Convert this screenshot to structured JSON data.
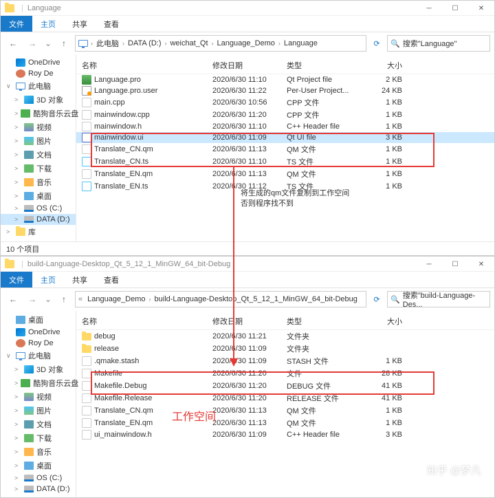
{
  "window1": {
    "title": "Language",
    "ribbon": {
      "file": "文件",
      "home": "主页",
      "share": "共享",
      "view": "查看"
    },
    "path": [
      "此电脑",
      "DATA (D:)",
      "weichat_Qt",
      "Language_Demo",
      "Language"
    ],
    "search_placeholder": "搜索\"Language\"",
    "columns": {
      "name": "名称",
      "date": "修改日期",
      "type": "类型",
      "size": "大小"
    },
    "files": [
      {
        "icon": "fi-pro",
        "name": "Language.pro",
        "date": "2020/6/30 11:10",
        "type": "Qt Project file",
        "size": "2 KB"
      },
      {
        "icon": "fi-user",
        "name": "Language.pro.user",
        "date": "2020/6/30 11:22",
        "type": "Per-User Project...",
        "size": "24 KB"
      },
      {
        "icon": "fi-cpp",
        "name": "main.cpp",
        "date": "2020/6/30 10:56",
        "type": "CPP 文件",
        "size": "1 KB"
      },
      {
        "icon": "fi-cpp",
        "name": "mainwindow.cpp",
        "date": "2020/6/30 11:20",
        "type": "CPP 文件",
        "size": "1 KB"
      },
      {
        "icon": "fi-h",
        "name": "mainwindow.h",
        "date": "2020/6/30 11:10",
        "type": "C++ Header file",
        "size": "1 KB"
      },
      {
        "icon": "fi-ui",
        "name": "mainwindow.ui",
        "date": "2020/6/30 11:09",
        "type": "Qt UI file",
        "size": "3 KB",
        "sel": true
      },
      {
        "icon": "fi-qm",
        "name": "Translate_CN.qm",
        "date": "2020/6/30 11:13",
        "type": "QM 文件",
        "size": "1 KB"
      },
      {
        "icon": "fi-ts",
        "name": "Translate_CN.ts",
        "date": "2020/6/30 11:10",
        "type": "TS 文件",
        "size": "1 KB"
      },
      {
        "icon": "fi-qm",
        "name": "Translate_EN.qm",
        "date": "2020/6/30 11:13",
        "type": "QM 文件",
        "size": "1 KB"
      },
      {
        "icon": "fi-ts",
        "name": "Translate_EN.ts",
        "date": "2020/6/30 11:12",
        "type": "TS 文件",
        "size": "1 KB"
      }
    ],
    "status": "10 个项目"
  },
  "window2": {
    "title": "build-Language-Desktop_Qt_5_12_1_MinGW_64_bit-Debug",
    "ribbon": {
      "file": "文件",
      "home": "主页",
      "share": "共享",
      "view": "查看"
    },
    "path": [
      "Language_Demo",
      "build-Language-Desktop_Qt_5_12_1_MinGW_64_bit-Debug"
    ],
    "search_placeholder": "搜索\"build-Language-Des...",
    "columns": {
      "name": "名称",
      "date": "修改日期",
      "type": "类型",
      "size": "大小"
    },
    "files": [
      {
        "icon": "fi-folder",
        "name": "debug",
        "date": "2020/6/30 11:21",
        "type": "文件夹",
        "size": ""
      },
      {
        "icon": "fi-folder",
        "name": "release",
        "date": "2020/6/30 11:09",
        "type": "文件夹",
        "size": ""
      },
      {
        "icon": "fi-make",
        "name": ".qmake.stash",
        "date": "2020/6/30 11:09",
        "type": "STASH 文件",
        "size": "1 KB"
      },
      {
        "icon": "fi-make",
        "name": "Makefile",
        "date": "2020/6/30 11:20",
        "type": "文件",
        "size": "28 KB"
      },
      {
        "icon": "fi-make",
        "name": "Makefile.Debug",
        "date": "2020/6/30 11:20",
        "type": "DEBUG 文件",
        "size": "41 KB"
      },
      {
        "icon": "fi-make",
        "name": "Makefile.Release",
        "date": "2020/6/30 11:20",
        "type": "RELEASE 文件",
        "size": "41 KB"
      },
      {
        "icon": "fi-qm",
        "name": "Translate_CN.qm",
        "date": "2020/6/30 11:13",
        "type": "QM 文件",
        "size": "1 KB"
      },
      {
        "icon": "fi-qm",
        "name": "Translate_EN.qm",
        "date": "2020/6/30 11:13",
        "type": "QM 文件",
        "size": "1 KB"
      },
      {
        "icon": "fi-h",
        "name": "ui_mainwindow.h",
        "date": "2020/6/30 11:09",
        "type": "C++ Header file",
        "size": "3 KB"
      }
    ]
  },
  "sidebar": [
    {
      "exp": "",
      "icon": "ico-onedrive",
      "label": "OneDrive"
    },
    {
      "exp": "",
      "icon": "ico-user",
      "label": "Roy De"
    },
    {
      "exp": "∨",
      "icon": "ico-pc",
      "label": "此电脑"
    },
    {
      "exp": ">",
      "icon": "ico-3d",
      "label": "3D 对象",
      "indent": 1
    },
    {
      "exp": ">",
      "icon": "ico-cloud",
      "label": "酷狗音乐云盘",
      "indent": 1
    },
    {
      "exp": ">",
      "icon": "ico-video",
      "label": "视频",
      "indent": 1
    },
    {
      "exp": ">",
      "icon": "ico-pic",
      "label": "图片",
      "indent": 1
    },
    {
      "exp": ">",
      "icon": "ico-doc",
      "label": "文档",
      "indent": 1
    },
    {
      "exp": ">",
      "icon": "ico-dl",
      "label": "下载",
      "indent": 1
    },
    {
      "exp": ">",
      "icon": "ico-music",
      "label": "音乐",
      "indent": 1
    },
    {
      "exp": ">",
      "icon": "ico-desktop",
      "label": "桌面",
      "indent": 1
    },
    {
      "exp": ">",
      "icon": "ico-disk",
      "label": "OS (C:)",
      "indent": 1
    },
    {
      "exp": ">",
      "icon": "ico-disk",
      "label": "DATA (D:)",
      "indent": 1,
      "sel": true
    },
    {
      "exp": ">",
      "icon": "ico-folder",
      "label": "库"
    }
  ],
  "sidebar2": [
    {
      "exp": "",
      "icon": "ico-desktop",
      "label": "桌面"
    },
    {
      "exp": "",
      "icon": "ico-onedrive",
      "label": "OneDrive"
    },
    {
      "exp": "",
      "icon": "ico-user",
      "label": "Roy De"
    },
    {
      "exp": "∨",
      "icon": "ico-pc",
      "label": "此电脑"
    },
    {
      "exp": ">",
      "icon": "ico-3d",
      "label": "3D 对象",
      "indent": 1
    },
    {
      "exp": ">",
      "icon": "ico-cloud",
      "label": "酷狗音乐云盘",
      "indent": 1
    },
    {
      "exp": ">",
      "icon": "ico-video",
      "label": "视频",
      "indent": 1
    },
    {
      "exp": ">",
      "icon": "ico-pic",
      "label": "图片",
      "indent": 1
    },
    {
      "exp": ">",
      "icon": "ico-doc",
      "label": "文档",
      "indent": 1
    },
    {
      "exp": ">",
      "icon": "ico-dl",
      "label": "下载",
      "indent": 1
    },
    {
      "exp": ">",
      "icon": "ico-music",
      "label": "音乐",
      "indent": 1
    },
    {
      "exp": ">",
      "icon": "ico-desktop",
      "label": "桌面",
      "indent": 1
    },
    {
      "exp": ">",
      "icon": "ico-disk",
      "label": "OS (C:)",
      "indent": 1
    },
    {
      "exp": ">",
      "icon": "ico-disk",
      "label": "DATA (D:)",
      "indent": 1
    }
  ],
  "annotation1_line1": "将生成的qm文件复制到工作空间",
  "annotation1_line2": "否则程序找不到",
  "annotation2": "工作空间",
  "watermark": "知乎 @梦凡"
}
